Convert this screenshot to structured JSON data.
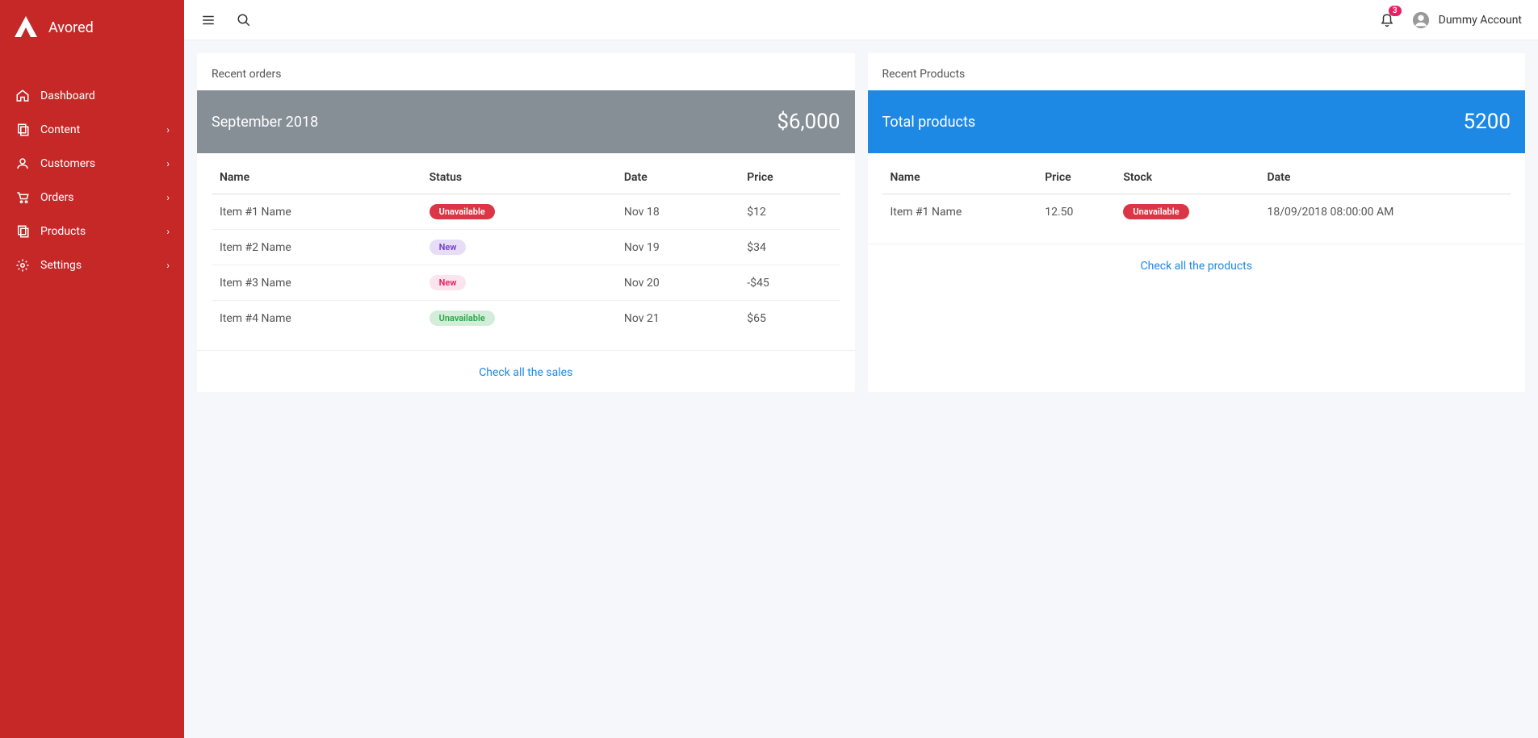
{
  "brand": "Avored",
  "nav": [
    {
      "label": "Dashboard",
      "has_chevron": false
    },
    {
      "label": "Content",
      "has_chevron": true
    },
    {
      "label": "Customers",
      "has_chevron": true
    },
    {
      "label": "Orders",
      "has_chevron": true
    },
    {
      "label": "Products",
      "has_chevron": true
    },
    {
      "label": "Settings",
      "has_chevron": true
    }
  ],
  "notif_count": "3",
  "account_name": "Dummy Account",
  "orders_card": {
    "title": "Recent orders",
    "period_label": "September 2018",
    "period_value": "$6,000",
    "columns": {
      "name": "Name",
      "status": "Status",
      "date": "Date",
      "price": "Price"
    },
    "rows": [
      {
        "name": "Item #1 Name",
        "status": "Unavailable",
        "badge_class": "badge-red",
        "date": "Nov 18",
        "price": "$12"
      },
      {
        "name": "Item #2 Name",
        "status": "New",
        "badge_class": "badge-purple",
        "date": "Nov 19",
        "price": "$34"
      },
      {
        "name": "Item #3 Name",
        "status": "New",
        "badge_class": "badge-pink",
        "date": "Nov 20",
        "price": "-$45"
      },
      {
        "name": "Item #4 Name",
        "status": "Unavailable",
        "badge_class": "badge-green",
        "date": "Nov 21",
        "price": "$65"
      }
    ],
    "footer_link": "Check all the sales"
  },
  "products_card": {
    "title": "Recent Products",
    "period_label": "Total products",
    "period_value": "5200",
    "columns": {
      "name": "Name",
      "price": "Price",
      "stock": "Stock",
      "date": "Date"
    },
    "rows": [
      {
        "name": "Item #1 Name",
        "price": "12.50",
        "stock": "Unavailable",
        "badge_class": "badge-red",
        "date": "18/09/2018 08:00:00 AM"
      }
    ],
    "footer_link": "Check all the products"
  }
}
